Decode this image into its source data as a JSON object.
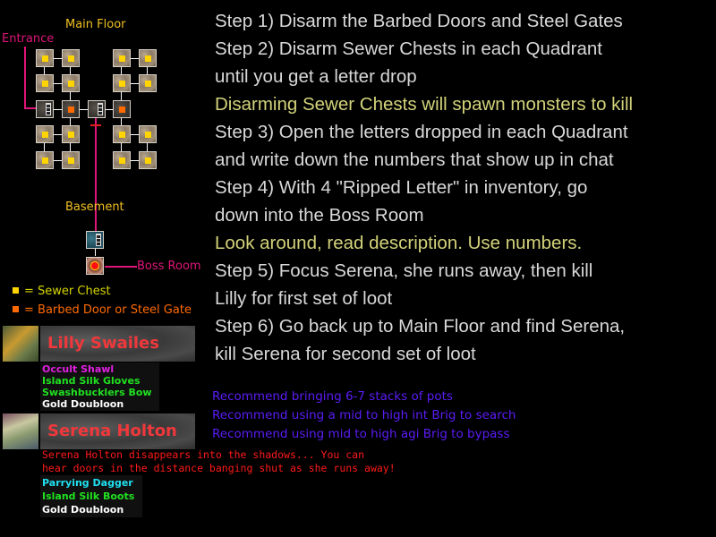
{
  "map": {
    "main_floor_label": "Main Floor",
    "entrance_label": "Entrance",
    "basement_label": "Basement",
    "boss_room_label": "Boss Room"
  },
  "legend": [
    {
      "label": "= Sewer Chest",
      "color": "#ffd400",
      "text_color": "#d6d600"
    },
    {
      "label": "= Barbed Door or Steel Gate",
      "color": "#ff6a00",
      "text_color": "#ff6a00"
    }
  ],
  "bosses": [
    {
      "name": "Lilly Swailes",
      "loot": [
        {
          "name": "Occult Shawl",
          "color": "#e020e0"
        },
        {
          "name": "Island Silk Gloves",
          "color": "#20e020"
        },
        {
          "name": "Swashbucklers Bow",
          "color": "#20e020"
        },
        {
          "name": "Gold Doubloon",
          "color": "#ffffff"
        }
      ]
    },
    {
      "name": "Serena Holton",
      "chat": [
        "Serena Holton disappears into the shadows... You can",
        "hear doors in the distance banging shut as she runs away!"
      ],
      "loot": [
        {
          "name": "Parrying Dagger",
          "color": "#20e0f0"
        },
        {
          "name": "Island Silk Boots",
          "color": "#20e020"
        },
        {
          "name": "Gold Doubloon",
          "color": "#ffffff"
        }
      ]
    }
  ],
  "steps": [
    {
      "text": "Step 1)  Disarm the Barbed Doors and Steel Gates",
      "note": false
    },
    {
      "text": "Step 2)  Disarm Sewer Chests in each Quadrant",
      "note": false
    },
    {
      "text": "until you get a letter drop",
      "note": false
    },
    {
      "text": "Disarming Sewer Chests will spawn monsters to kill",
      "note": true
    },
    {
      "text": "Step 3)  Open the letters dropped in each Quadrant",
      "note": false
    },
    {
      "text": "and write down the numbers that show up in chat",
      "note": false
    },
    {
      "text": "Step 4)  With 4 \"Ripped Letter\" in inventory, go",
      "note": false
    },
    {
      "text": "down into the Boss Room",
      "note": false
    },
    {
      "text": "Look around, read description. Use numbers.",
      "note": true
    },
    {
      "text": "Step 5)  Focus Serena, she runs away, then kill",
      "note": false
    },
    {
      "text": "Lilly for first set of loot",
      "note": false
    },
    {
      "text": "Step 6) Go back up to Main Floor and find Serena,",
      "note": false
    },
    {
      "text": "kill Serena for second set of loot",
      "note": false
    }
  ],
  "recommendations": [
    "Recommend bringing 6-7 stacks of pots",
    "Recommend using a mid to high int Brig to search",
    "Recommend using mid to high agi Brig to bypass"
  ],
  "colors": {
    "step_text": "#d8d8d8",
    "note_text": "#d2d27a",
    "map_label": "#f0c020",
    "pink_line": "#e0157a",
    "boss_name": "#f0383c",
    "recommend": "#5a1cf5",
    "chat": "#ff1a1a"
  }
}
